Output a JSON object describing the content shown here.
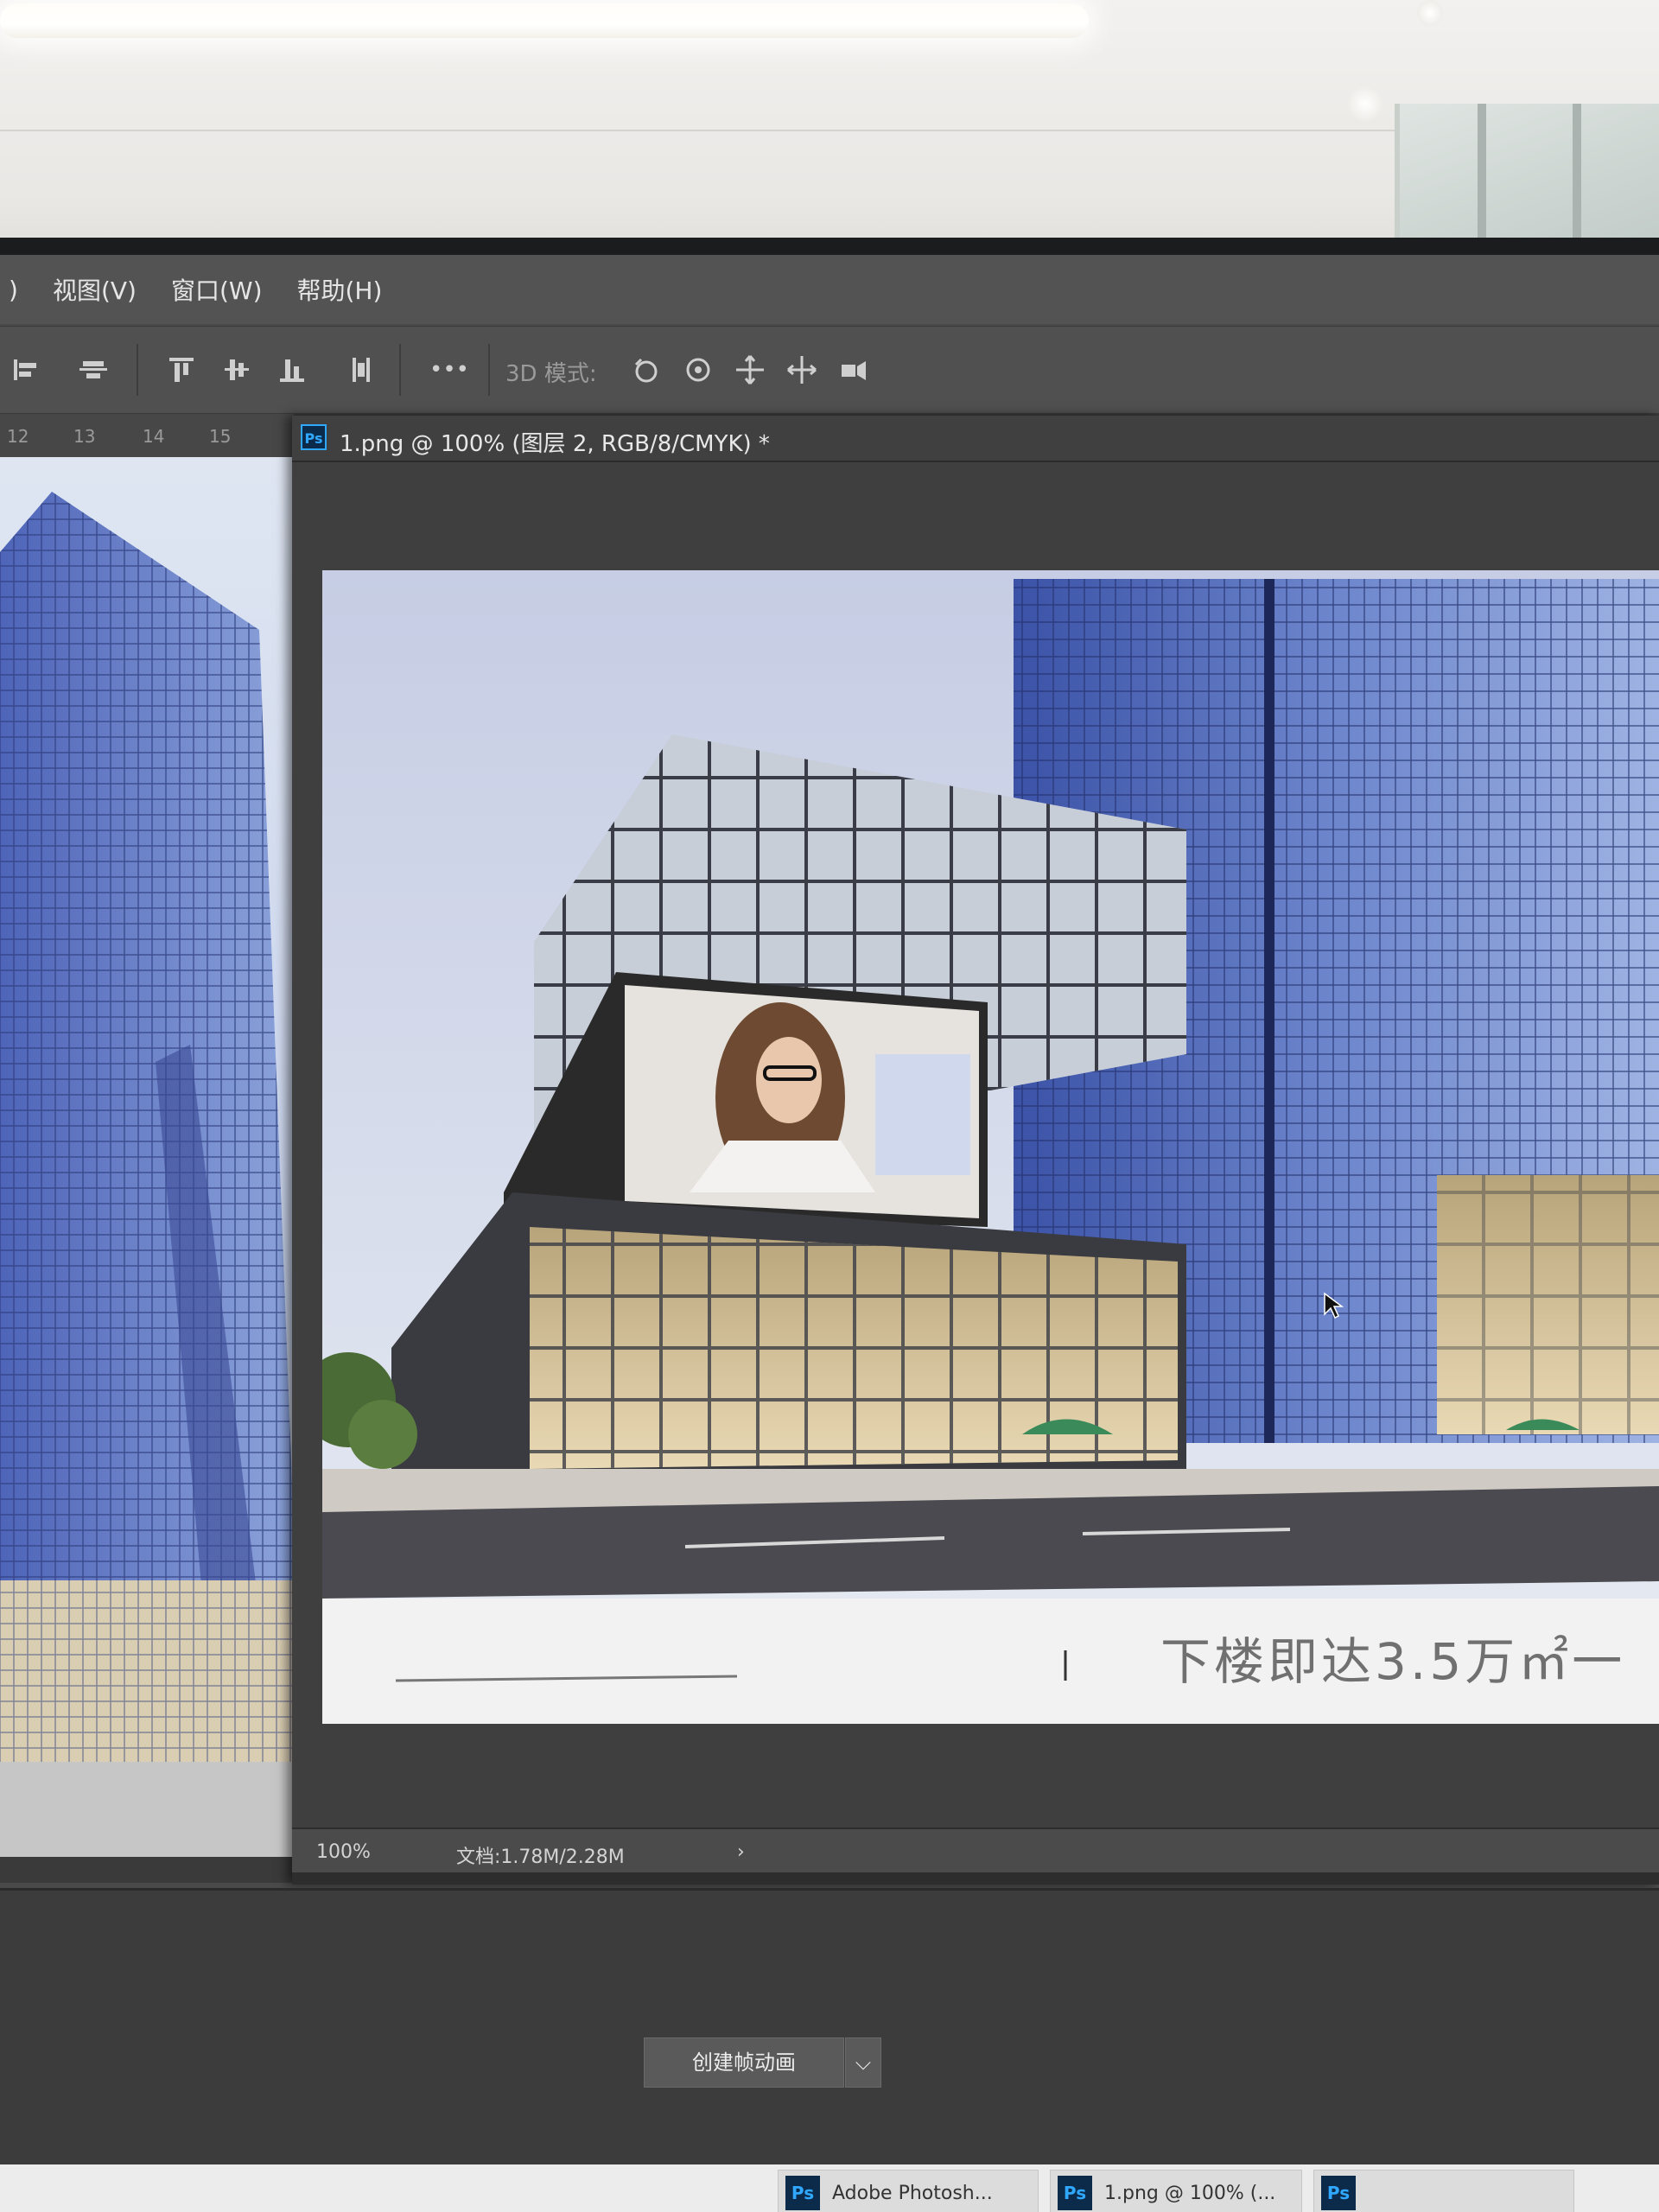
{
  "menu": {
    "items": [
      {
        "label": ")"
      },
      {
        "label": "视图(V)"
      },
      {
        "label": "窗口(W)"
      },
      {
        "label": "帮助(H)"
      }
    ]
  },
  "options_bar": {
    "mode_label": "3D 模式:",
    "more_label": "•••",
    "icons": [
      "align-left-icon",
      "align-vcenter-icon",
      "align-top-icon",
      "align-middle-icon",
      "align-bottom-icon",
      "distribute-icon",
      "orbit-3d-icon",
      "roll-3d-icon",
      "drag-3d-icon",
      "slide-3d-icon",
      "scale-3d-icon"
    ]
  },
  "ruler": {
    "ticks": [
      "12",
      "13",
      "14",
      "15"
    ]
  },
  "document": {
    "tab_title": "1.png @ 100% (图层 2, RGB/8/CMYK) *",
    "ps_badge": "Ps",
    "caption": "下楼即达3.5万㎡一",
    "zoom": "100%",
    "doc_info": "文档:1.78M/2.28M",
    "status_arrow": "›"
  },
  "timeline": {
    "create_label": "创建帧动画",
    "dropdown_glyph": "⌵"
  },
  "taskbar": {
    "items": [
      {
        "badge": "Ps",
        "label": "Adobe Photosh..."
      },
      {
        "badge": "Ps",
        "label": "1.png @ 100% (..."
      },
      {
        "badge": "Ps",
        "label": ""
      }
    ]
  },
  "colors": {
    "ps_blue": "#31a8ff",
    "panel_dark": "#3a3a3a",
    "menu_bg": "#535353"
  }
}
